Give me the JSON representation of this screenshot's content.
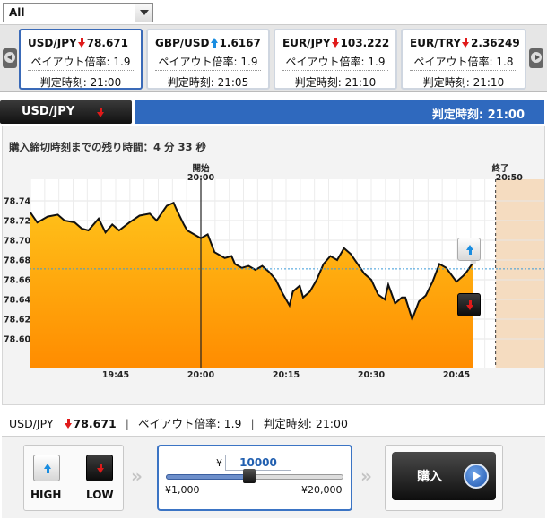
{
  "market_select": {
    "value": "All"
  },
  "tickers": [
    {
      "pair": "USD/JPY",
      "direction": "down",
      "rate": "78.671",
      "payout": "ペイアウト倍率: 1.9",
      "judge_time": "判定時刻: 21:00",
      "active": true
    },
    {
      "pair": "GBP/USD",
      "direction": "up",
      "rate": "1.6167",
      "payout": "ペイアウト倍率: 1.9",
      "judge_time": "判定時刻: 21:05",
      "active": false
    },
    {
      "pair": "EUR/JPY",
      "direction": "down",
      "rate": "103.222",
      "payout": "ペイアウト倍率: 1.9",
      "judge_time": "判定時刻: 21:10",
      "active": false
    },
    {
      "pair": "EUR/TRY",
      "direction": "down",
      "rate": "2.36249",
      "payout": "ペイアウト倍率: 1.8",
      "judge_time": "判定時刻: 21:10",
      "active": false
    }
  ],
  "pair_bar": {
    "pair": "USD/JPY",
    "direction": "down"
  },
  "time_bar": {
    "label": "判定時刻: 21:00"
  },
  "remaining": {
    "label": "購入締切時刻までの残り時間：4 分 33 秒"
  },
  "chart_data": {
    "type": "area",
    "title": "",
    "xlabel": "",
    "ylabel": "",
    "ylim": [
      78.59,
      78.75
    ],
    "yticks": [
      "78.74",
      "78.72",
      "78.70",
      "78.68",
      "78.66",
      "78.64",
      "78.62",
      "78.60"
    ],
    "xticks": [
      {
        "t": 19.75,
        "label": "19:45"
      },
      {
        "t": 20.0,
        "label": "20:00"
      },
      {
        "t": 20.25,
        "label": "20:15"
      },
      {
        "t": 20.5,
        "label": "20:30"
      },
      {
        "t": 20.75,
        "label": "20:45"
      }
    ],
    "xlim": [
      19.5,
      21.0
    ],
    "start_marker": {
      "t": 20.0,
      "label": "開始",
      "time": "20:00"
    },
    "end_marker": {
      "t": 20.8333,
      "label": "終了",
      "time": "20:50"
    },
    "current_rate": 78.671,
    "series": [
      {
        "t": [
          19.5,
          19.52,
          19.55,
          19.58,
          19.6,
          19.63,
          19.65,
          19.67,
          19.7,
          19.72,
          19.74,
          19.76,
          19.79,
          19.82,
          19.85,
          19.87,
          19.9,
          19.92,
          19.93,
          19.95,
          19.96,
          19.98,
          20.0,
          20.02,
          20.04,
          20.07,
          20.09,
          20.1,
          20.12,
          20.14,
          20.16,
          20.18,
          20.2,
          20.22,
          20.24,
          20.26,
          20.27,
          20.29,
          20.3,
          20.32,
          20.34,
          20.36,
          20.38,
          20.4,
          20.42,
          20.44,
          20.46,
          20.48,
          20.5,
          20.52,
          20.54,
          20.55,
          20.57,
          20.59,
          20.6,
          20.62,
          20.64,
          20.66,
          20.68,
          20.7,
          20.72,
          20.75,
          20.77,
          20.78,
          20.8
        ],
        "values": [
          78.728,
          78.718,
          78.724,
          78.726,
          78.72,
          78.718,
          78.712,
          78.71,
          78.722,
          78.708,
          78.716,
          78.71,
          78.718,
          78.725,
          78.727,
          78.72,
          78.735,
          78.738,
          78.73,
          78.716,
          78.71,
          78.706,
          78.702,
          78.706,
          78.688,
          78.682,
          78.684,
          78.676,
          78.672,
          78.674,
          78.67,
          78.674,
          78.668,
          78.66,
          78.646,
          78.634,
          78.648,
          78.654,
          78.642,
          78.648,
          78.66,
          78.676,
          78.684,
          78.68,
          78.692,
          78.686,
          78.676,
          78.666,
          78.66,
          78.645,
          78.64,
          78.655,
          78.636,
          78.642,
          78.642,
          78.62,
          78.638,
          78.644,
          78.658,
          78.676,
          78.672,
          78.658,
          78.664,
          78.668,
          78.678
        ]
      }
    ],
    "grid": true
  },
  "info": {
    "pair": "USD/JPY",
    "direction": "down",
    "rate": "78.671",
    "payout": "ペイアウト倍率: 1.9",
    "judge_time": "判定時刻: 21:00",
    "separator": "|"
  },
  "trade": {
    "high_label": "HIGH",
    "low_label": "LOW",
    "chevrons": "»",
    "currency_symbol": "¥",
    "amount": "10000",
    "slider_min": "¥1,000",
    "slider_max": "¥20,000",
    "slider_value": 10000,
    "slider_range": [
      1000,
      20000
    ],
    "buy_label": "購入"
  },
  "colors": {
    "accent_blue": "#2f69be",
    "area_top": "#ffc21a",
    "area_bottom": "#ff8c00",
    "down_red": "#e01a1a",
    "up_blue": "#1a8de0",
    "current_line": "#3a9ad9",
    "after_region": "#f5dcc0"
  }
}
